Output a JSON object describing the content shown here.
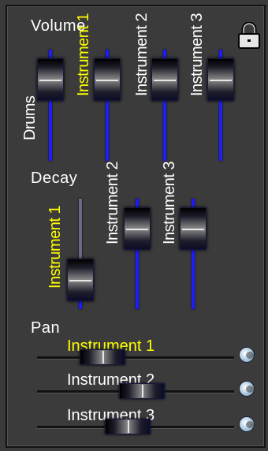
{
  "volume": {
    "title": "Volume",
    "channels": [
      {
        "label": "Drums",
        "level": 0.87,
        "active": false
      },
      {
        "label": "Instrument 1",
        "level": 0.87,
        "active": true
      },
      {
        "label": "Instrument 2",
        "level": 0.87,
        "active": false
      },
      {
        "label": "Instrument 3",
        "level": 0.87,
        "active": false
      }
    ]
  },
  "decay": {
    "title": "Decay",
    "channels": [
      {
        "label": "Instrument 1",
        "level": 0.12,
        "active": true
      },
      {
        "label": "Instrument 2",
        "level": 0.87,
        "active": false
      },
      {
        "label": "Instrument 3",
        "level": 0.87,
        "active": false
      }
    ]
  },
  "pan": {
    "title": "Pan",
    "channels": [
      {
        "label": "Instrument 1",
        "value": 0.28,
        "active": true
      },
      {
        "label": "Instrument 2",
        "value": 0.54,
        "active": false
      },
      {
        "label": "Instrument 3",
        "value": 0.45,
        "active": false
      }
    ]
  },
  "icons": {
    "lock": "lock-icon",
    "reset": "reset-pan-icon"
  },
  "colors": {
    "active_label": "#ffff00",
    "track": "#1c1cff"
  }
}
